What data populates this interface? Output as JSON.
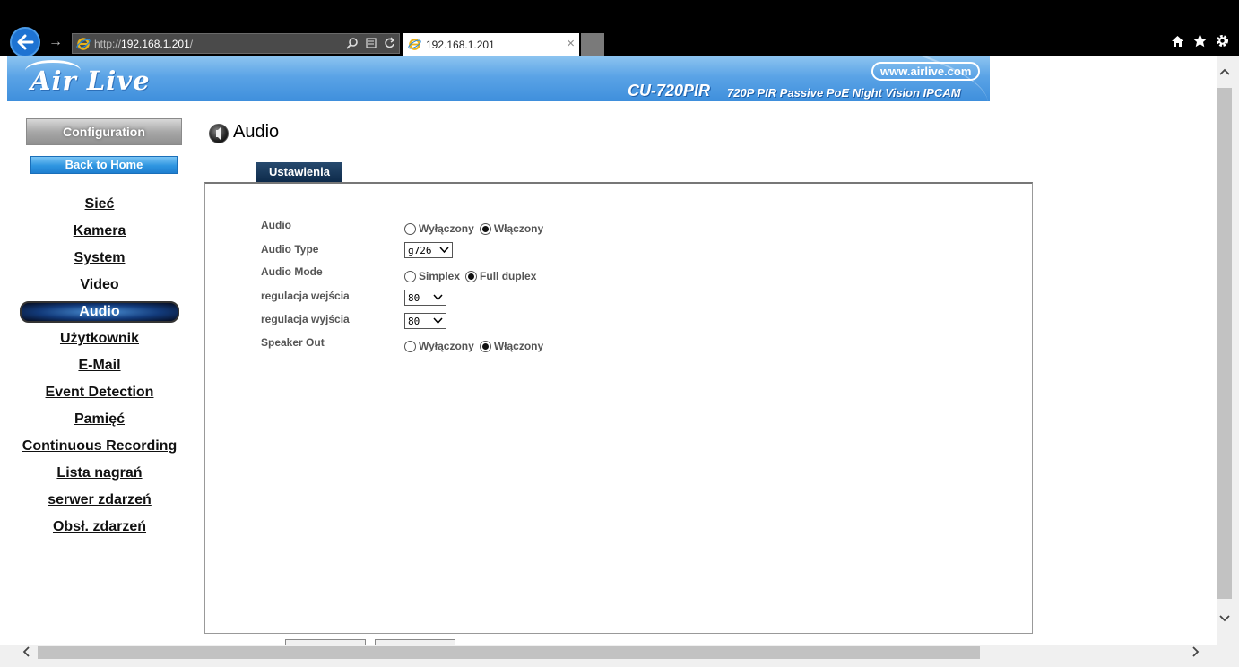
{
  "browser": {
    "address_prefix": "http://",
    "address_host": "192.168.1.201",
    "address_suffix": "/",
    "tab_title": "192.168.1.201",
    "tab_close": "×",
    "forward_icon": "→"
  },
  "banner": {
    "logo": "Air Live",
    "site_link": "www.airlive.com",
    "model": "CU-720PIR",
    "model_desc": "720P PIR Passive PoE Night Vision IPCAM"
  },
  "sidebar": {
    "configuration": "Configuration",
    "back_home": "Back to Home",
    "items": [
      {
        "label": "Sieć"
      },
      {
        "label": "Kamera"
      },
      {
        "label": "System"
      },
      {
        "label": "Video"
      },
      {
        "label": "Audio"
      },
      {
        "label": "Użytkownik"
      },
      {
        "label": "E-Mail"
      },
      {
        "label": "Event Detection"
      },
      {
        "label": "Pamięć"
      },
      {
        "label": "Continuous Recording"
      },
      {
        "label": "Lista nagrań"
      },
      {
        "label": "serwer zdarzeń"
      },
      {
        "label": "Obsł. zdarzeń"
      }
    ],
    "active_index": 4
  },
  "content": {
    "title": "Audio",
    "tab_label": "Ustawienia",
    "rows": {
      "audio": {
        "label": "Audio",
        "opt_off": "Wyłączony",
        "opt_on": "Włączony",
        "selected": "on"
      },
      "audio_type": {
        "label": "Audio Type",
        "value": "g726"
      },
      "audio_mode": {
        "label": "Audio Mode",
        "opt_a": "Simplex",
        "opt_b": "Full duplex",
        "selected": "b"
      },
      "input_gain": {
        "label": "regulacja wejścia",
        "value": "80"
      },
      "output_gain": {
        "label": "regulacja wyjścia",
        "value": "80"
      },
      "speaker_out": {
        "label": "Speaker Out",
        "opt_off": "Wyłączony",
        "opt_on": "Włączony",
        "selected": "on"
      }
    }
  }
}
